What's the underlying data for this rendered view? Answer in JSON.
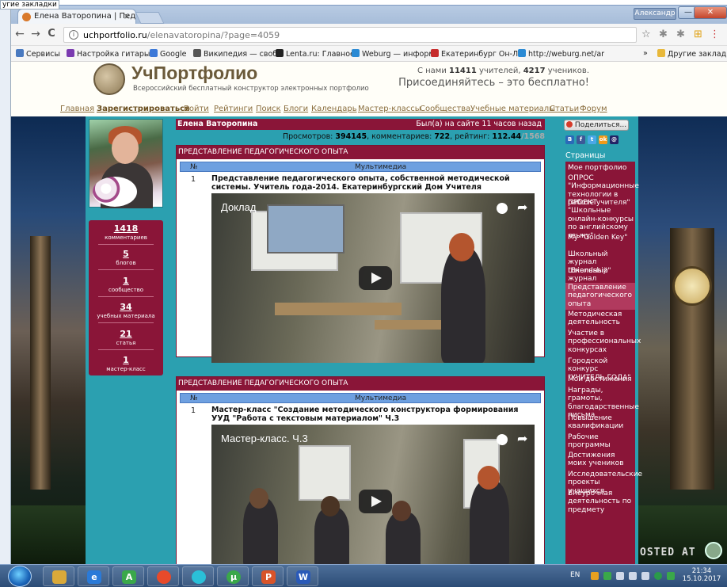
{
  "desktop": {
    "left_label": "угие закладки"
  },
  "browser": {
    "tab_title": "Елена Ватоpопина | Пед",
    "tab_close": "×",
    "user_chip": "Александр",
    "win_min": "—",
    "win_max": "□",
    "win_close": "✕",
    "back": "←",
    "forward": "→",
    "reload": "C",
    "url_host": "uchportfolio.ru",
    "url_path": "/elenavatoropina/?page=4059",
    "bookmarks": [
      "Сервисы",
      "Настройка гитары о",
      "Google",
      "Википедия — свобо",
      "Lenta.ru: Главное:",
      "Weburg — информа",
      "Екатеринбург Он-Лі",
      "http://weburg.net/ar"
    ],
    "bookmarks_more": "»",
    "other_bookmarks": "Другие закладки"
  },
  "site": {
    "logo_title": "УчПортфолио",
    "logo_subtitle": "Всероссийский бесплатный конструктор электронных портфолио",
    "stats_prefix": "С нами",
    "teachers_count": "11411",
    "teachers_label": "учителей,",
    "students_count": "4217",
    "students_label": "учеников.",
    "join_text": "Присоединяйтесь – это бесплатно!",
    "nav": [
      "Главная",
      "Зарегистрироваться",
      "Войти",
      "Рейтинги",
      "Поиск",
      "Блоги",
      "Календарь",
      "Мастер-классы",
      "Сообщества",
      "Учебные материалы",
      "Статьи",
      "Форум"
    ]
  },
  "profile": {
    "name": "Елена Ватоpопина",
    "last_seen": "Был(а) на сайте 11 часов назад",
    "views_label": "Просмотров:",
    "views": "394145",
    "comments_label": "комментариев:",
    "comments": "722",
    "rating_label": "рейтинг:",
    "rating": "112.44",
    "rating_total": "/1568",
    "stats": [
      {
        "n": "1418",
        "t": "комментариев"
      },
      {
        "n": "5",
        "t": "блогов"
      },
      {
        "n": "1",
        "t": "сообщество"
      },
      {
        "n": "34",
        "t": "учебных материала"
      },
      {
        "n": "21",
        "t": "статья"
      },
      {
        "n": "1",
        "t": "мастер-класс"
      }
    ]
  },
  "blocks": [
    {
      "heading": "ПРЕДСТАВЛЕНИЕ ПЕДАГОГИЧЕСКОГО ОПЫТА",
      "col1": "№",
      "col2": "Мультимедиа",
      "num": "1",
      "title": "Представление педагогического опыта, собственной методической системы. Учитель года-2014. Екатеринбургский Дом Учителя",
      "video_title": "Доклад"
    },
    {
      "heading": "ПРЕДСТАВЛЕНИЕ ПЕДАГОГИЧЕСКОГО ОПЫТА",
      "col1": "№",
      "col2": "Мультимедиа",
      "num": "1",
      "title": "Мастер-класс \"Создание методического конструктора формирования УУД \"Работа с текстовым материалом\" Ч.3",
      "video_title": "Мастер-класс. Ч.3"
    }
  ],
  "sidebar": {
    "share_label": "Поделиться...",
    "social": [
      "B",
      "f",
      "t",
      "ok",
      "@"
    ],
    "pages_label": "Страницы",
    "pages": [
      "Мое портфолио",
      "ОПРОС \"Информационные технологии в работе учителя\"",
      "ПРОЕКТ \"Школьные онлайн-конкурсы по английскому языку\"",
      "My \"Golden Key\"",
      "Школьный журнал \"Friendship\"",
      "Школьный журнал \"TeenLife\"",
      "Представление педагогического опыта",
      "Методическая деятельность",
      "Участие в профессиональных конкурсах",
      "Городской конкурс \"УЧИТЕЛЬ ГОДА\"",
      "Мои достижения",
      "Награды, грамоты, благодарственные письма",
      "Повышение квалификации",
      "Рабочие программы",
      "Достижения моих учеников",
      "Исследовательские проекты учащихся",
      "Внеурочная деятельность по предмету"
    ],
    "active_page_index": 6
  },
  "background": {
    "watermark": "OSTED AT"
  },
  "taskbar": {
    "apps": [
      "explorer",
      "ie",
      "a",
      "chrome",
      "media",
      "torrent",
      "ppt",
      "word"
    ],
    "lang": "EN",
    "time": "21:34",
    "date": "15.10.2017"
  },
  "colors": {
    "accent": "#8a1538",
    "page_bg": "#2ba0b0",
    "table_head": "#6ea0e0"
  }
}
